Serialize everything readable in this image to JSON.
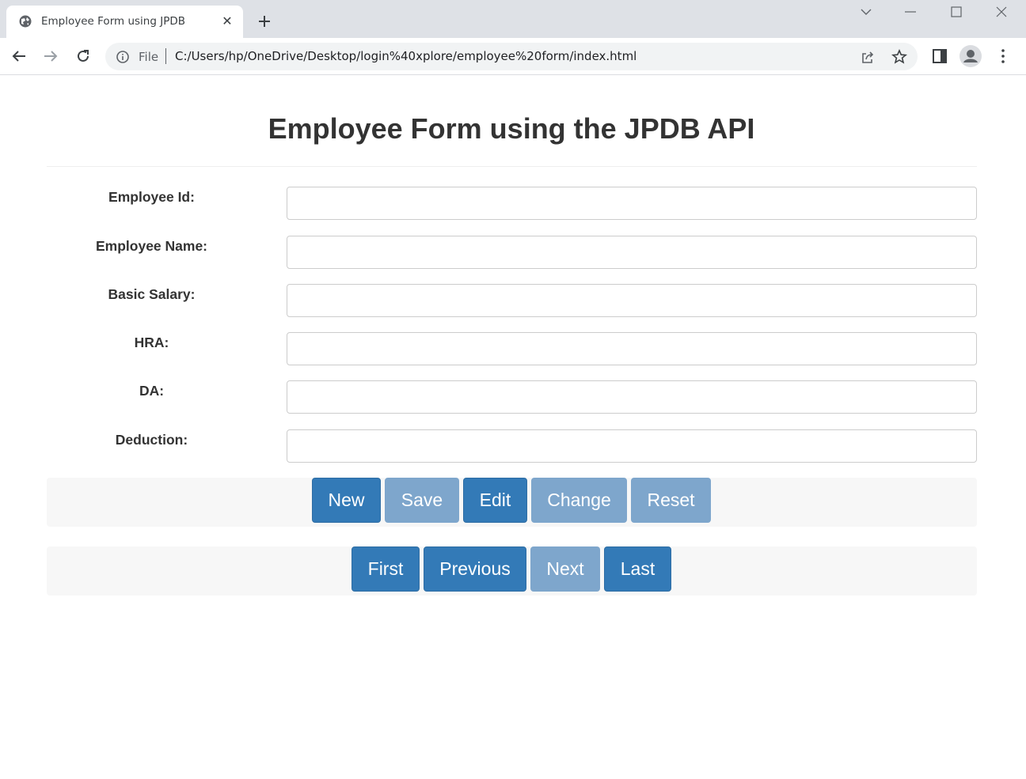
{
  "browser": {
    "tab_title": "Employee Form using JPDB",
    "scheme_label": "File",
    "url": "C:/Users/hp/OneDrive/Desktop/login%40xplore/employee%20form/index.html"
  },
  "page": {
    "title": "Employee Form using the JPDB API"
  },
  "form": {
    "fields": [
      {
        "label": "Employee Id:",
        "value": ""
      },
      {
        "label": "Employee Name:",
        "value": ""
      },
      {
        "label": "Basic Salary:",
        "value": ""
      },
      {
        "label": "HRA:",
        "value": ""
      },
      {
        "label": "DA:",
        "value": ""
      },
      {
        "label": "Deduction:",
        "value": ""
      }
    ]
  },
  "actions": {
    "new": "New",
    "save": "Save",
    "edit": "Edit",
    "change": "Change",
    "reset": "Reset"
  },
  "navigation": {
    "first": "First",
    "previous": "Previous",
    "next": "Next",
    "last": "Last"
  },
  "colors": {
    "primary": "#337ab7",
    "primary_disabled": "#7ea6cc",
    "heading": "#333333"
  }
}
